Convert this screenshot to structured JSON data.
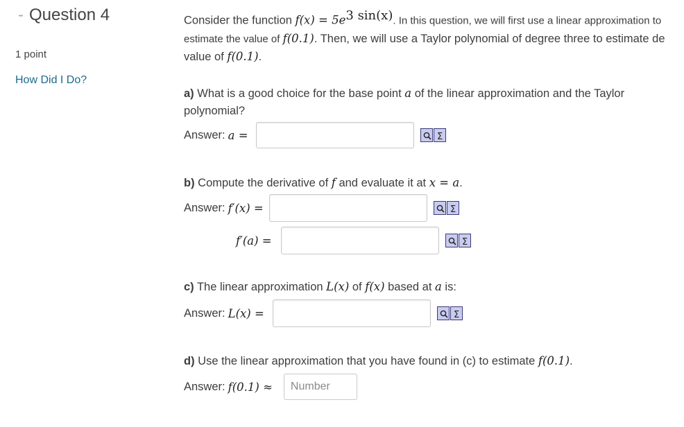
{
  "sidebar": {
    "question_dash": "-",
    "question_title": "Question 4",
    "points": "1 point",
    "how_link": "How Did I Do?"
  },
  "intro": {
    "prefix": "Consider the function ",
    "function_expr": "f(x) = 5e",
    "function_exponent": "3 sin(x)",
    "part1": ". In this question, we will first use a linear approximation to estimate the value of ",
    "f01": "f(0.1)",
    "part2": ". Then, we will use a Taylor polynomial of degree three to estimate de value of ",
    "f01b": "f(0.1)",
    "part3": "."
  },
  "part_a": {
    "label": "a)",
    "text_before": " What is a good choice for the base point ",
    "var": "a",
    "text_after": " of the linear approximation and the Taylor polynomial?",
    "answer_label": "Answer: ",
    "answer_math": "a ="
  },
  "part_b": {
    "label": "b)",
    "text1": " Compute the derivative of ",
    "var_f": "f",
    "text2": " and evaluate it at ",
    "eq": "x = a",
    "text3": ".",
    "answer_label": "Answer: ",
    "math1": "f′(x) =",
    "math2": "f′(a) ="
  },
  "part_c": {
    "label": "c)",
    "text1": " The linear approximation ",
    "Lx": "L(x)",
    "text2": " of ",
    "fx": "f(x)",
    "text3": " based at ",
    "var": "a",
    "text4": " is:",
    "answer_label": "Answer: ",
    "math": "L(x) ="
  },
  "part_d": {
    "label": "d)",
    "text1": " Use the linear approximation that you have found in (c) to estimate ",
    "f01": "f(0.1)",
    "text2": ".",
    "answer_label": "Answer: ",
    "math": "f(0.1) ≈",
    "placeholder": "Number"
  },
  "icons": [
    "preview-icon",
    "equation-editor-icon"
  ]
}
